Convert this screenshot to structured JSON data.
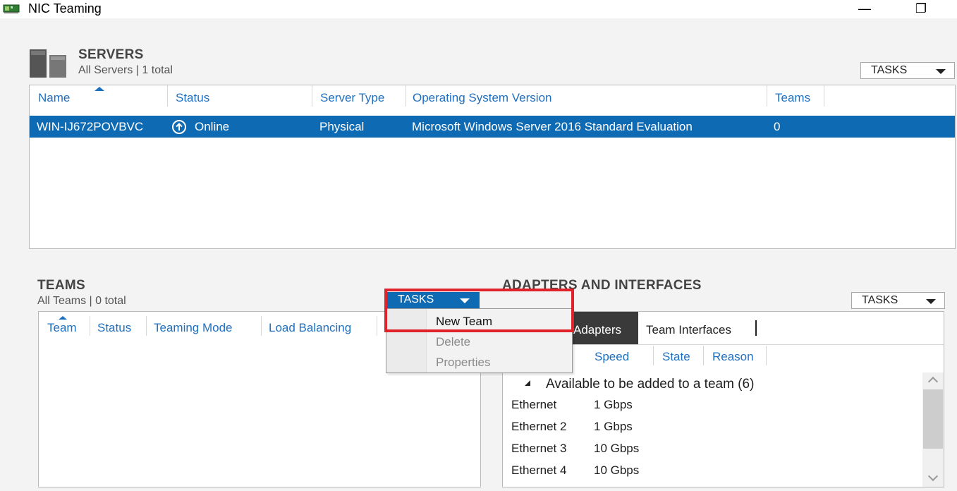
{
  "window": {
    "title": "NIC Teaming",
    "minimize_glyph": "—",
    "restore_glyph": "❐"
  },
  "servers": {
    "title": "SERVERS",
    "subtitle": "All Servers | 1 total",
    "tasks_label": "TASKS",
    "columns": [
      "Name",
      "Status",
      "Server Type",
      "Operating System Version",
      "Teams"
    ],
    "rows": [
      {
        "name": "WIN-IJ672POVBVC",
        "status": "Online",
        "server_type": "Physical",
        "os_version": "Microsoft Windows Server 2016 Standard Evaluation",
        "teams": "0"
      }
    ]
  },
  "teams": {
    "title": "TEAMS",
    "subtitle": "All Teams | 0 total",
    "tasks_label": "TASKS",
    "columns": [
      "Team",
      "Status",
      "Teaming Mode",
      "Load Balancing"
    ]
  },
  "tasks_menu": {
    "items": [
      "New Team",
      "Delete",
      "Properties"
    ]
  },
  "adapters": {
    "title": "ADAPTERS AND INTERFACES",
    "tasks_label": "TASKS",
    "tabs": [
      "Network Adapters",
      "Team Interfaces"
    ],
    "active_tab_visible_text": "Adapters",
    "columns": [
      "Speed",
      "State",
      "Reason"
    ],
    "group_label": "Available to be added to a team (6)",
    "rows": [
      {
        "name": "Ethernet",
        "speed": "1 Gbps"
      },
      {
        "name": "Ethernet 2",
        "speed": "1 Gbps"
      },
      {
        "name": "Ethernet 3",
        "speed": "10 Gbps"
      },
      {
        "name": "Ethernet 4",
        "speed": "10 Gbps"
      }
    ]
  },
  "colors": {
    "accent": "#0f6ab4",
    "header_text": "#1f6fbf",
    "highlight_box": "#e0222a"
  }
}
